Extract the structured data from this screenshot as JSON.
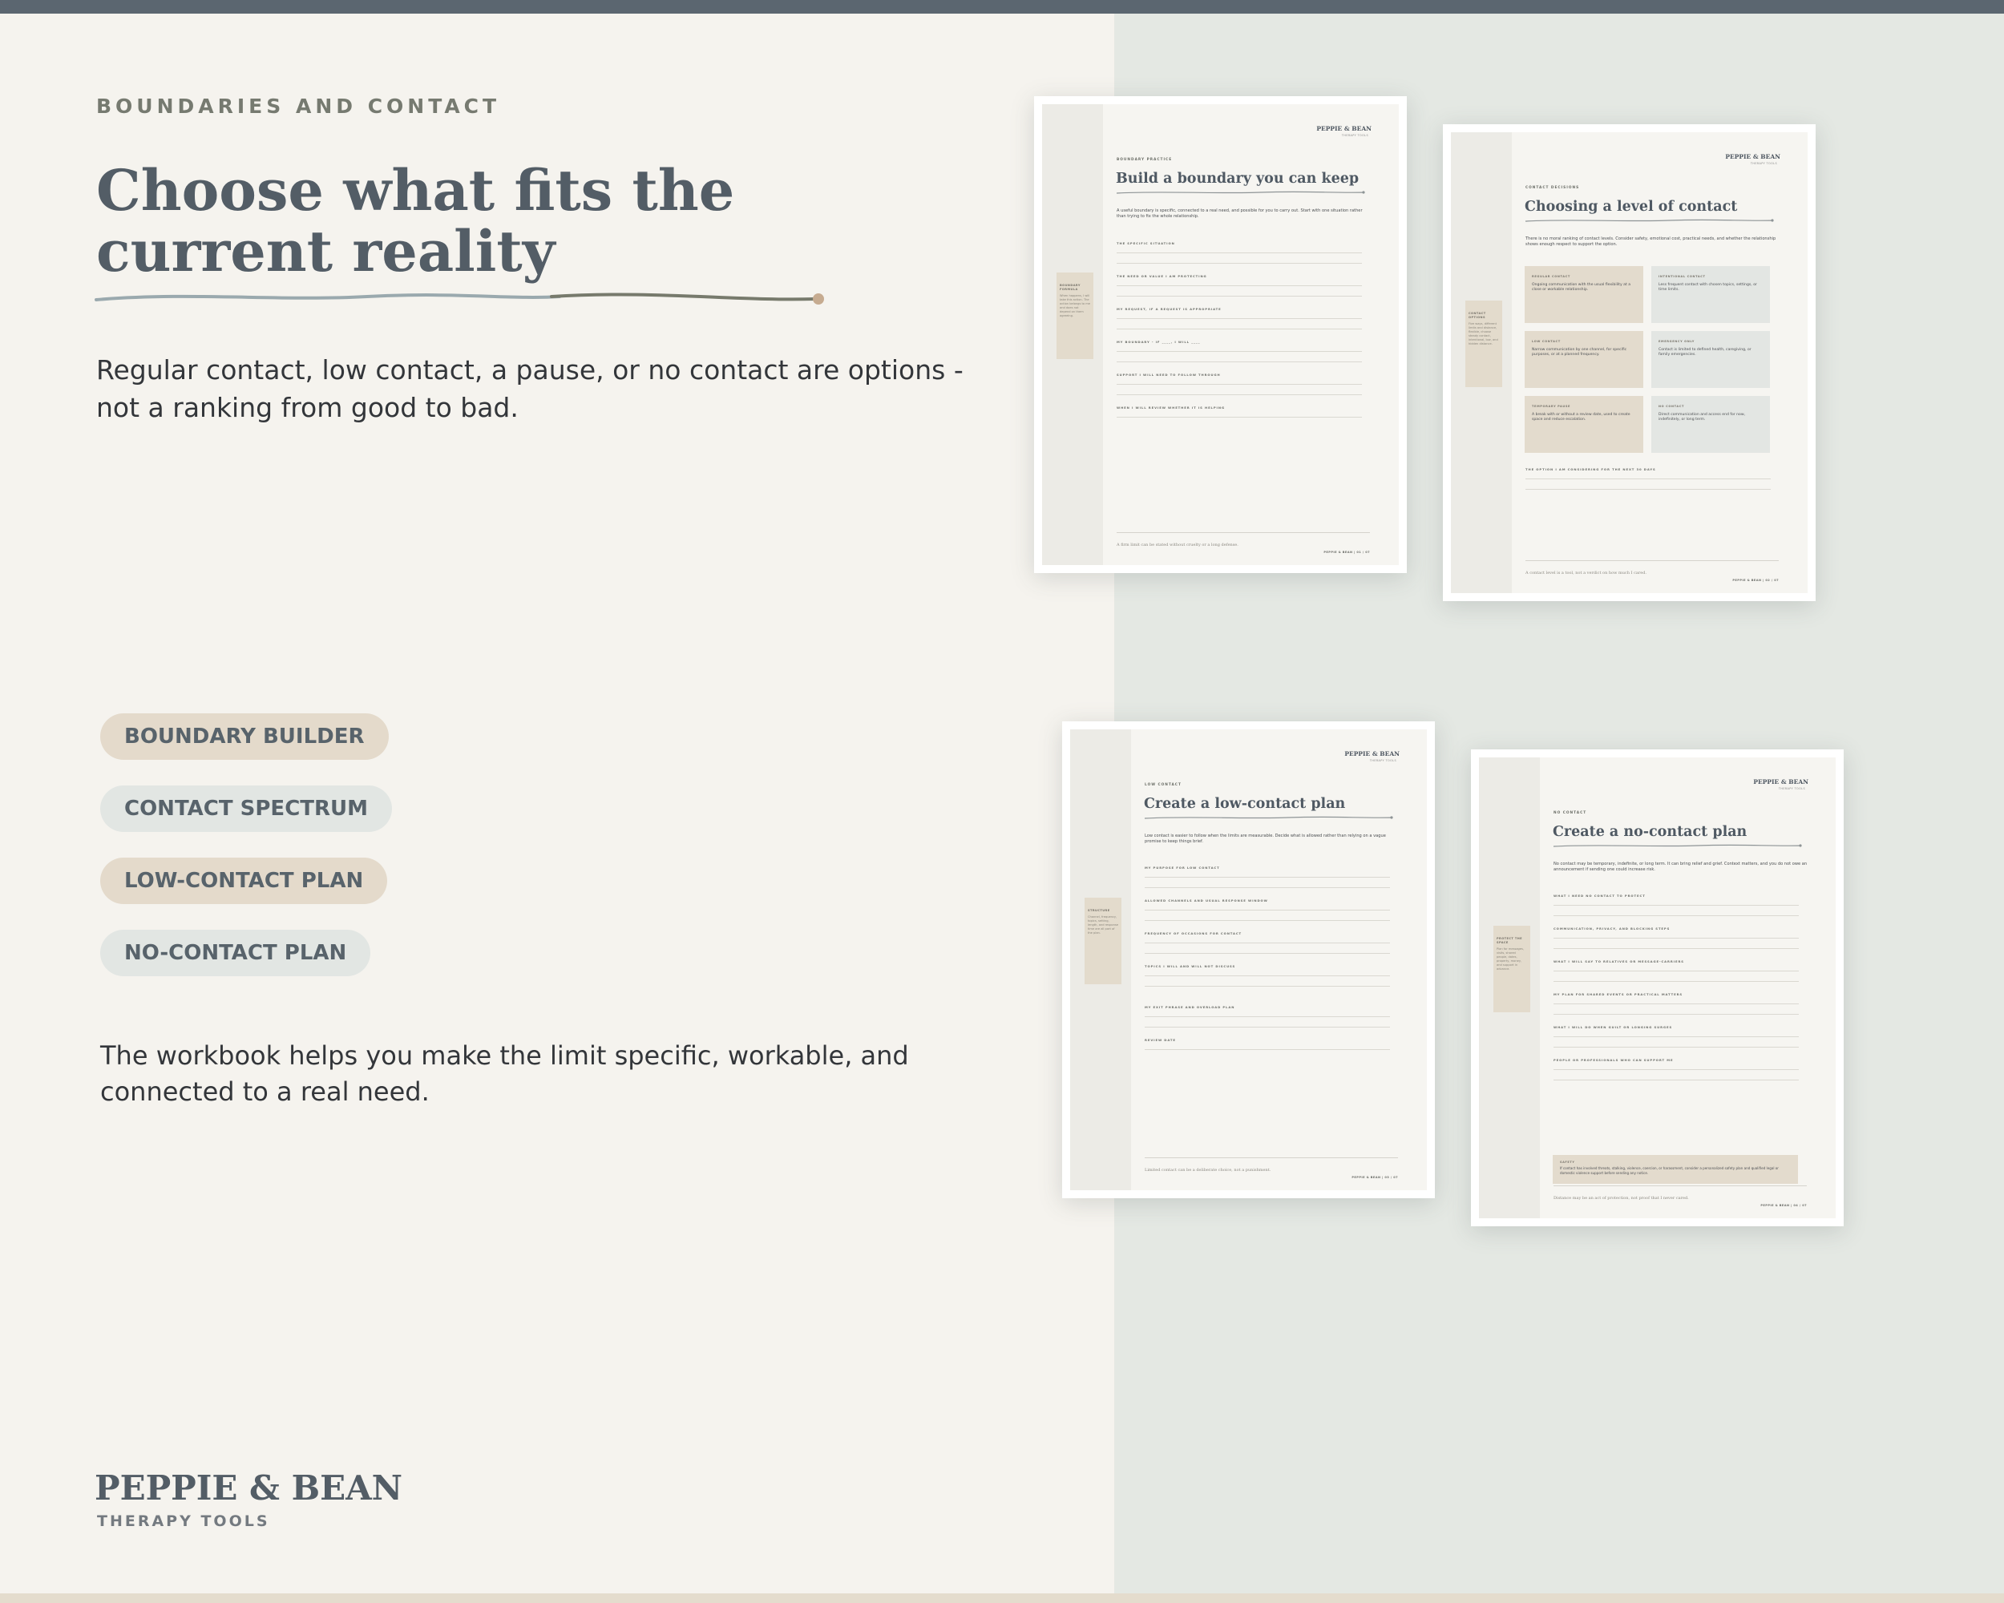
{
  "colors": {
    "slate": "#535d66",
    "tan": "#e4dacb",
    "mist": "#e4e8e3",
    "paper": "#f5f3ee"
  },
  "hero": {
    "eyebrow": "BOUNDARIES AND CONTACT",
    "title": "Choose what fits the current reality",
    "intro": "Regular contact, low contact, a pause, or no contact are options - not a ranking from good to bad."
  },
  "chips": [
    {
      "label": "BOUNDARY BUILDER"
    },
    {
      "label": "CONTACT SPECTRUM"
    },
    {
      "label": "LOW-CONTACT PLAN"
    },
    {
      "label": "NO-CONTACT PLAN"
    }
  ],
  "workbook_note": "The workbook helps you make the limit specific, workable, and connected to a real need.",
  "brand": {
    "name": "PEPPIE & BEAN",
    "tagline": "THERAPY TOOLS"
  },
  "sheets": [
    {
      "brand": "PEPPIE & BEAN",
      "brand_tag": "THERAPY TOOLS",
      "eyebrow": "BOUNDARY PRACTICE",
      "title": "Build a boundary you can keep",
      "intro": "A useful boundary is specific, connected to a real need, and possible for you to carry out. Start with one situation rather than trying to fix the whole relationship.",
      "side_title": "BOUNDARY FORMULA",
      "side_text": "When happens, I will take this action. The action belongs to me and does not depend on them agreeing.",
      "prompts": [
        "THE SPECIFIC SITUATION",
        "THE NEED OR VALUE I AM PROTECTING",
        "MY REQUEST, IF A REQUEST IS APPROPRIATE",
        "MY BOUNDARY - IF ____, I WILL ____",
        "SUPPORT I WILL NEED TO FOLLOW THROUGH",
        "WHEN I WILL REVIEW WHETHER IT IS HELPING"
      ],
      "footer": "A firm limit can be stated without cruelty or a long defense.",
      "page": "PEPPIE & BEAN | 01 / 07"
    },
    {
      "brand": "PEPPIE & BEAN",
      "brand_tag": "THERAPY TOOLS",
      "eyebrow": "CONTACT DECISIONS",
      "title": "Choosing a level of contact",
      "intro": "There is no moral ranking of contact levels. Consider safety, emotional cost, practical needs, and whether the relationship shows enough respect to support the option.",
      "side_title": "CONTACT OPTIONS",
      "side_text": "Five ways, different limits and distance, flexible, choose steady contact, intentional, low, and hidden distance.",
      "options": [
        {
          "label": "REGULAR CONTACT",
          "text": "Ongoing communication with the usual flexibility at a close or workable relationship."
        },
        {
          "label": "INTENTIONAL CONTACT",
          "text": "Less frequent contact with chosen topics, settings, or time limits."
        },
        {
          "label": "LOW CONTACT",
          "text": "Narrow communication by one channel, for specific purposes, or at a planned frequency."
        },
        {
          "label": "EMERGENCY ONLY",
          "text": "Contact is limited to defined health, caregiving, or family emergencies."
        },
        {
          "label": "TEMPORARY PAUSE",
          "text": "A break with or without a review date, used to create space and reduce escalation."
        },
        {
          "label": "NO CONTACT",
          "text": "Direct communication and access end for now, indefinitely, or long term."
        }
      ],
      "prompts": [
        "THE OPTION I AM CONSIDERING FOR THE NEXT 30 DAYS"
      ],
      "footer": "A contact level is a tool, not a verdict on how much I cared.",
      "page": "PEPPIE & BEAN | 02 / 07"
    },
    {
      "brand": "PEPPIE & BEAN",
      "brand_tag": "THERAPY TOOLS",
      "eyebrow": "LOW CONTACT",
      "title": "Create a low-contact plan",
      "intro": "Low contact is easier to follow when the limits are measurable. Decide what is allowed rather than relying on a vague promise to keep things brief.",
      "side_title": "STRUCTURE",
      "side_text": "Channel, frequency, topics, setting, length, and response time are all part of the plan.",
      "prompts": [
        "MY PURPOSE FOR LOW CONTACT",
        "ALLOWED CHANNELS AND USUAL RESPONSE WINDOW",
        "FREQUENCY OF OCCASIONS FOR CONTACT",
        "TOPICS I WILL AND WILL NOT DISCUSS",
        "MY EXIT PHRASE AND OVERLOAD PLAN",
        "REVIEW DATE"
      ],
      "footer": "Limited contact can be a deliberate choice, not a punishment.",
      "page": "PEPPIE & BEAN | 03 / 07"
    },
    {
      "brand": "PEPPIE & BEAN",
      "brand_tag": "THERAPY TOOLS",
      "eyebrow": "NO CONTACT",
      "title": "Create a no-contact plan",
      "intro": "No contact may be temporary, indefinite, or long term. It can bring relief and grief. Context matters, and you do not owe an announcement if sending one could increase risk.",
      "side_title": "PROTECT THE SPACE",
      "side_text": "Plan for messages, visits, shared people, dates, property, money, and support in advance.",
      "prompts": [
        "WHAT I NEED NO CONTACT TO PROTECT",
        "COMMUNICATION, PRIVACY, AND BLOCKING STEPS",
        "WHAT I WILL SAY TO RELATIVES OR MESSAGE-CARRIERS",
        "MY PLAN FOR SHARED EVENTS OR PRACTICAL MATTERS",
        "WHAT I WILL DO WHEN GUILT OR LONGING SURGES",
        "PEOPLE OR PROFESSIONALS WHO CAN SUPPORT ME"
      ],
      "safety_label": "SAFETY",
      "safety_text": "If contact has involved threats, stalking, violence, coercion, or harassment, consider a personalized safety plan and qualified legal or domestic violence support before sending any notice.",
      "footer": "Distance may be an act of protection, not proof that I never cared.",
      "page": "PEPPIE & BEAN | 04 / 07"
    }
  ]
}
